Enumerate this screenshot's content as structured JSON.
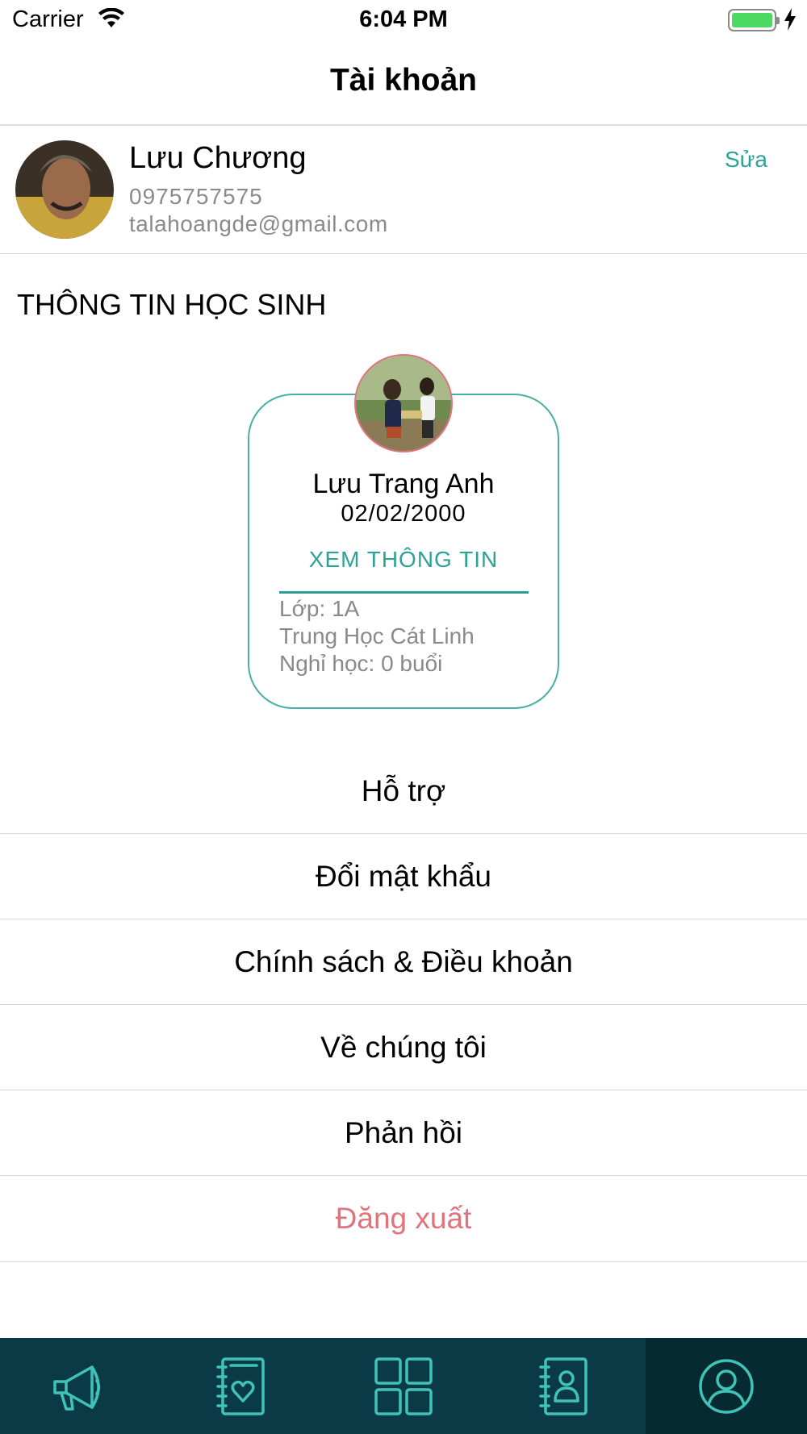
{
  "status_bar": {
    "carrier": "Carrier",
    "time": "6:04 PM",
    "icons": [
      "wifi-icon",
      "battery-icon",
      "charging-icon"
    ],
    "battery_color": "#4cd964"
  },
  "header": {
    "title": "Tài khoản"
  },
  "profile": {
    "name": "Lưu Chương",
    "phone": "0975757575",
    "email": "talahoangde@gmail.com",
    "edit_label": "Sửa"
  },
  "student_section": {
    "title": "THÔNG TIN HỌC SINH",
    "student": {
      "name": "Lưu Trang Anh",
      "dob": "02/02/2000",
      "view_label": "XEM THÔNG TIN",
      "class": "Lớp: 1A",
      "school": "Trung Học Cát Linh",
      "absences": "Nghỉ học: 0 buổi"
    }
  },
  "menu": {
    "support": "Hỗ trợ",
    "change_password": "Đổi mật khẩu",
    "policy": "Chính sách & Điều khoản",
    "about": "Về chúng tôi",
    "feedback": "Phản hồi",
    "logout": "Đăng xuất"
  },
  "tab_bar": {
    "tabs": [
      "megaphone-icon",
      "notebook-heart-icon",
      "grid-icon",
      "contacts-book-icon",
      "user-circle-icon"
    ],
    "active_index": 4
  },
  "colors": {
    "accent": "#2ea297",
    "logout": "#e0737c",
    "tab_bar": "#0b3a47",
    "tab_active": "#062a32",
    "tab_icon": "#3fc3b8"
  }
}
